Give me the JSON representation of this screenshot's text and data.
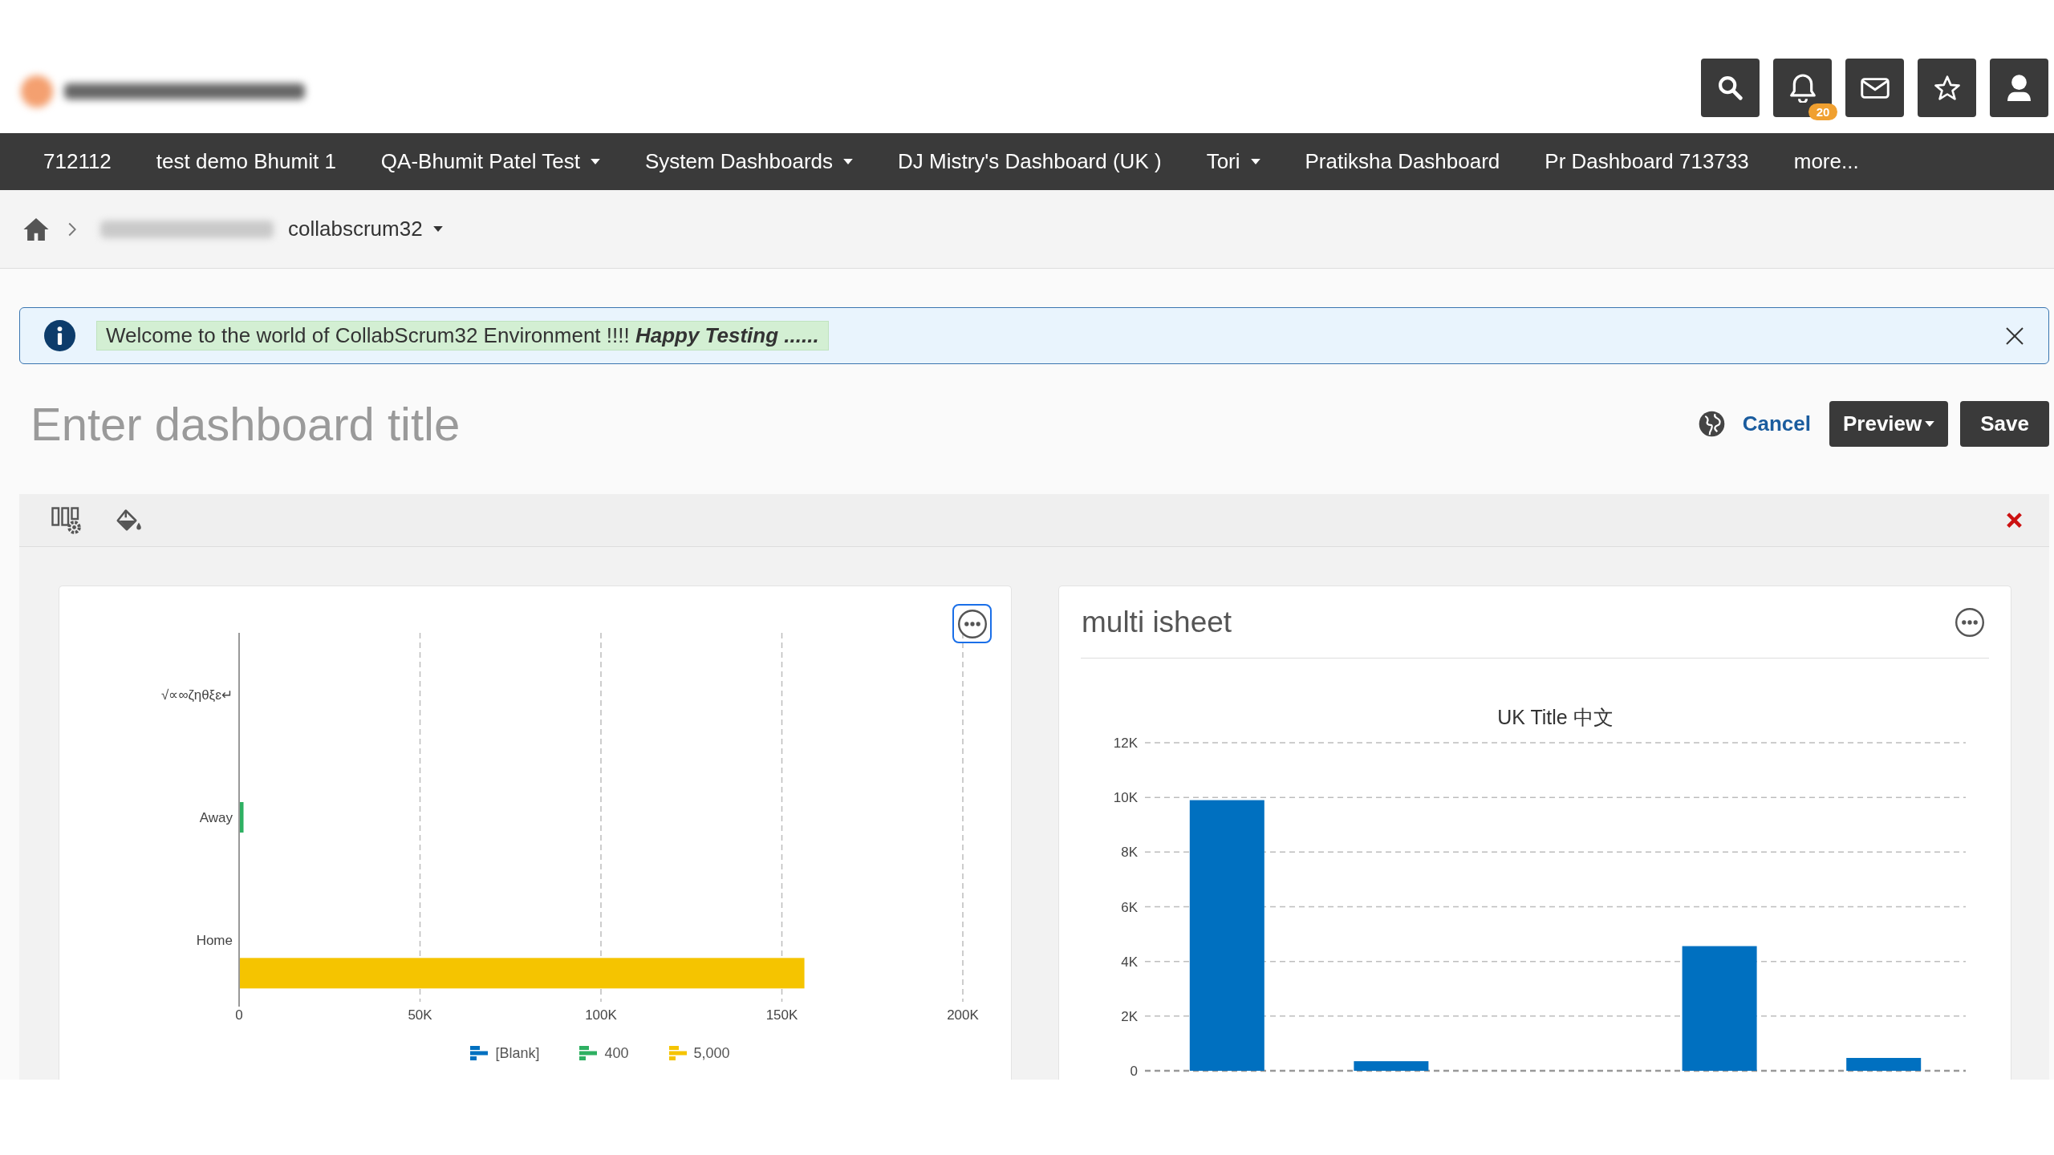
{
  "header": {
    "notification_count": "20"
  },
  "nav": [
    {
      "label": "712112",
      "has_dropdown": false
    },
    {
      "label": "test demo Bhumit 1",
      "has_dropdown": false
    },
    {
      "label": "QA-Bhumit Patel Test",
      "has_dropdown": true
    },
    {
      "label": "System Dashboards",
      "has_dropdown": true
    },
    {
      "label": "DJ Mistry's Dashboard (UK )",
      "has_dropdown": false
    },
    {
      "label": "Tori",
      "has_dropdown": true
    },
    {
      "label": "Pratiksha Dashboard",
      "has_dropdown": false
    },
    {
      "label": "Pr Dashboard 713733",
      "has_dropdown": false
    },
    {
      "label": "more...",
      "has_dropdown": false
    }
  ],
  "breadcrumb": {
    "current": "collabscrum32"
  },
  "alert": {
    "message": "Welcome to the world of CollabScrum32 Environment !!!! *Happy Testing ......*"
  },
  "title_field": {
    "placeholder": "Enter dashboard title"
  },
  "actions": {
    "cancel": "Cancel",
    "preview": "Preview",
    "save": "Save"
  },
  "widgets": [
    {
      "focused": true,
      "chart_data": {
        "type": "bar",
        "orientation": "horizontal",
        "grid": true,
        "categories": [
          "√∝∞ζηθξɛ↵",
          "Away",
          "Home"
        ],
        "series": [
          {
            "name": "[Blank]",
            "color": "#0070c0",
            "values": [
              0,
              0,
              0
            ]
          },
          {
            "name": "400",
            "color": "#2eb062",
            "values": [
              0,
              1000,
              0
            ]
          },
          {
            "name": "5,000",
            "color": "#f5c400",
            "values": [
              0,
              0,
              156000
            ]
          }
        ],
        "xlim": [
          0,
          200000
        ],
        "xticks": [
          {
            "value": 0,
            "label": "0"
          },
          {
            "value": 50000,
            "label": "50K"
          },
          {
            "value": 100000,
            "label": "100K"
          },
          {
            "value": 150000,
            "label": "150K"
          },
          {
            "value": 200000,
            "label": "200K"
          }
        ]
      }
    },
    {
      "title": "multi isheet",
      "focused": false,
      "chart_data": {
        "type": "bar",
        "orientation": "vertical",
        "grid": true,
        "title": "UK Title 中文",
        "values": [
          9900,
          350,
          0,
          4560,
          470
        ],
        "ylim": [
          0,
          12000
        ],
        "yticks": [
          {
            "value": 0,
            "label": "0"
          },
          {
            "value": 2000,
            "label": "2K"
          },
          {
            "value": 4000,
            "label": "4K"
          },
          {
            "value": 6000,
            "label": "6K"
          },
          {
            "value": 8000,
            "label": "8K"
          },
          {
            "value": 10000,
            "label": "10K"
          },
          {
            "value": 12000,
            "label": "12K"
          }
        ]
      }
    }
  ]
}
